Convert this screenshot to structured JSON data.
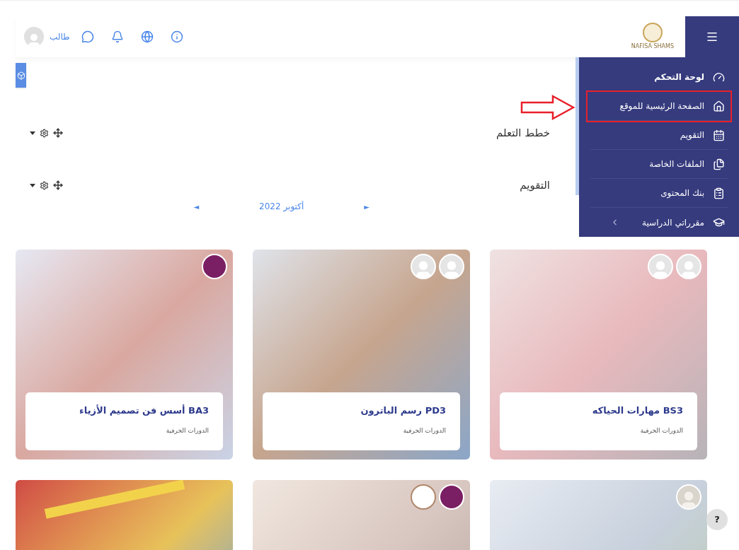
{
  "header": {
    "user_name": "طالب",
    "logo_caption": "NAFISA SHAMS"
  },
  "drawer": {
    "items": [
      {
        "kind": "dashboard",
        "label": "لوحة التحكم",
        "bold": true,
        "highlighted": false,
        "has_children": false
      },
      {
        "kind": "home",
        "label": "الصفحة الرئيسية للموقع",
        "bold": false,
        "highlighted": true,
        "has_children": false
      },
      {
        "kind": "calendar",
        "label": "التقويم",
        "bold": false,
        "highlighted": false,
        "has_children": false
      },
      {
        "kind": "files",
        "label": "الملفات الخاصة",
        "bold": false,
        "highlighted": false,
        "has_children": false
      },
      {
        "kind": "bank",
        "label": "بنك المحتوى",
        "bold": false,
        "highlighted": false,
        "has_children": false
      },
      {
        "kind": "courses",
        "label": "مقرراتي الدراسية",
        "bold": false,
        "highlighted": false,
        "has_children": true
      }
    ]
  },
  "blocks": [
    {
      "title": "خطط التعلم"
    },
    {
      "title": "التقويم"
    }
  ],
  "calendar": {
    "prev": "◄",
    "month": "أكتوبر 2022",
    "next": "►"
  },
  "cards": [
    {
      "title": "BS3 مهارات الحياكه",
      "category": "الدورات الحرفية",
      "avatars": [
        {
          "kind": "user"
        },
        {
          "kind": "user"
        }
      ]
    },
    {
      "title": "PD3 رسم الباترون",
      "category": "الدورات الحرفية",
      "avatars": [
        {
          "kind": "user"
        },
        {
          "kind": "user"
        }
      ]
    },
    {
      "title": "BA3 أسس فن تصميم الأزياء",
      "category": "الدورات الحرفية",
      "avatars": [
        {
          "kind": "logo"
        }
      ]
    },
    {
      "avatars": [
        {
          "kind": "person"
        }
      ]
    },
    {
      "avatars": [
        {
          "kind": "logo"
        },
        {
          "kind": "monogram"
        }
      ]
    },
    {
      "kind": "photo"
    }
  ],
  "help": "?"
}
